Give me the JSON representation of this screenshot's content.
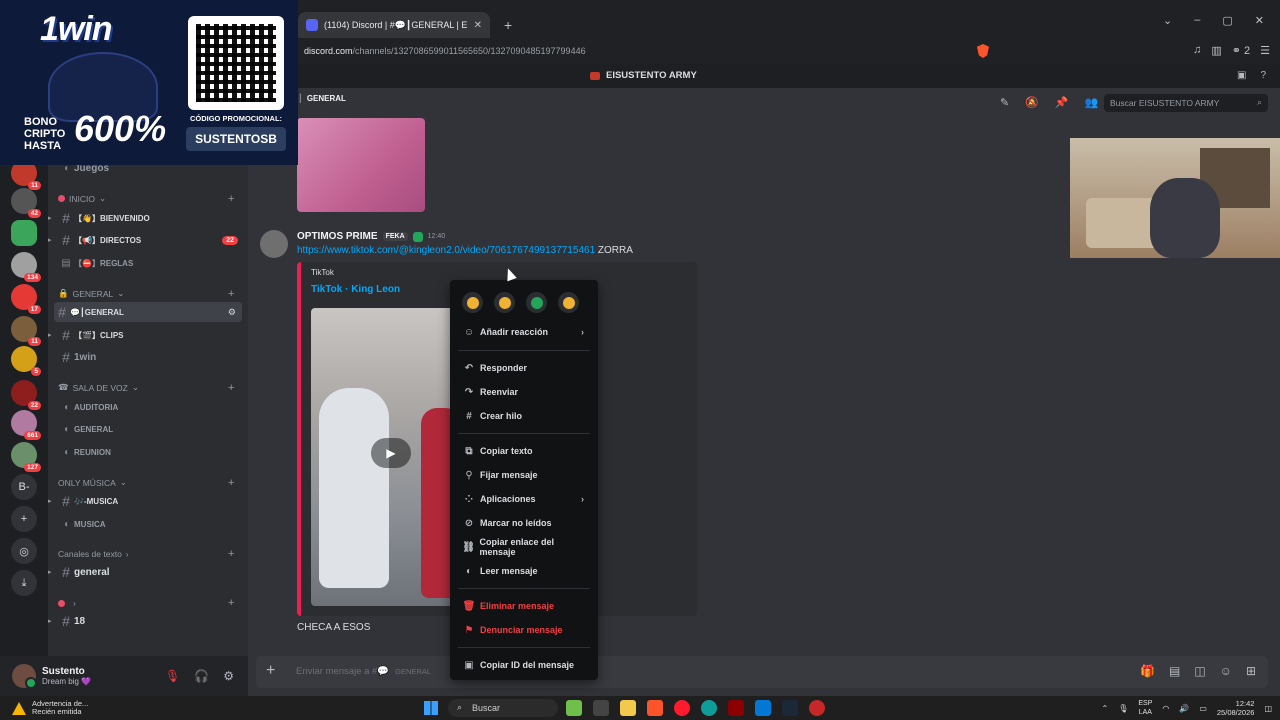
{
  "browser": {
    "tab_title": "(1104) Discord | #💬┃GENERAL | E",
    "new_tab": "+",
    "url_host": "discord.com",
    "url_path": "/channels/1327086599011565650/1327090485197799446",
    "profile_count": "2",
    "controls": {
      "minimize": "–",
      "maximize": "▢",
      "close": "✕",
      "dropdown": "⌄"
    }
  },
  "server": {
    "name": "EISUSTENTO ARMY"
  },
  "promo": {
    "logo": "1win",
    "bono_text": "BONO CRIPTO HASTA",
    "percent": "600%",
    "code_label": "CÓDIGO PROMOCIONAL:",
    "code": "SUSTENTOSB"
  },
  "rail_badges": [
    "11",
    "42",
    "134",
    "17",
    "11",
    "5",
    "22",
    "661",
    "127"
  ],
  "rail_text_server": "B-",
  "channels": {
    "top_partial": "Juegos",
    "cat_inicio": "INICIO",
    "bienvenido": "【👋】BIENVENIDO",
    "directos": "【📢】DIRECTOS",
    "directos_mentions": "22",
    "reglas": "【⛔】REGLAS",
    "cat_general": "GENERAL",
    "general": "💬┃GENERAL",
    "clips": "【🎬】CLIPS",
    "onewin": "1win",
    "cat_voz": "SALA DE VOZ",
    "auditoria": "AUDITORIA",
    "voz_general": "GENERAL",
    "reunion": "REUNION",
    "cat_musica": "ONLY MÚSICA",
    "musica_text": "🎶-MUSICA",
    "musica_voice": "MUSICA",
    "cat_texto": "Canales de texto",
    "text_general": "general",
    "cat_unnamed": "",
    "ch_18": "18"
  },
  "user": {
    "name": "Sustento",
    "status": "Dream big 💜"
  },
  "chat": {
    "channel_header": "GENERAL",
    "search_placeholder": "Buscar EISUSTENTO ARMY",
    "author": "OPTIMOS PRIME",
    "author_tag": "FEKA",
    "time": "12:40",
    "link": "https://www.tiktok.com/@kingleon2.0/video/7061767499137715461",
    "link_suffix": "ZORRA",
    "embed_provider": "TikTok",
    "embed_title": "TikTok · King Leon",
    "message2": "CHECA A ESOS",
    "composer_placeholder": "Enviar mensaje a #💬",
    "composer_channel": "GENERAL"
  },
  "context_menu": {
    "add_reaction": "Añadir reacción",
    "reply": "Responder",
    "forward": "Reenviar",
    "create_thread": "Crear hilo",
    "copy_text": "Copiar texto",
    "pin": "Fijar mensaje",
    "apps": "Aplicaciones",
    "mark_unread": "Marcar no leídos",
    "copy_link": "Copiar enlace del mensaje",
    "read_message": "Leer mensaje",
    "delete": "Eliminar mensaje",
    "report": "Denunciar mensaje",
    "copy_id": "Copiar ID del mensaje",
    "reaction_colors": [
      "#f0b232",
      "#f0b232",
      "#23a55a",
      "#f0b232"
    ]
  },
  "taskbar": {
    "warning_title": "Advertencia de...",
    "warning_sub": "Recién emitida",
    "search": "Buscar",
    "lang_top": "ESP",
    "lang_bottom": "LAA",
    "time": "12:42",
    "date": "25/08/2026"
  }
}
